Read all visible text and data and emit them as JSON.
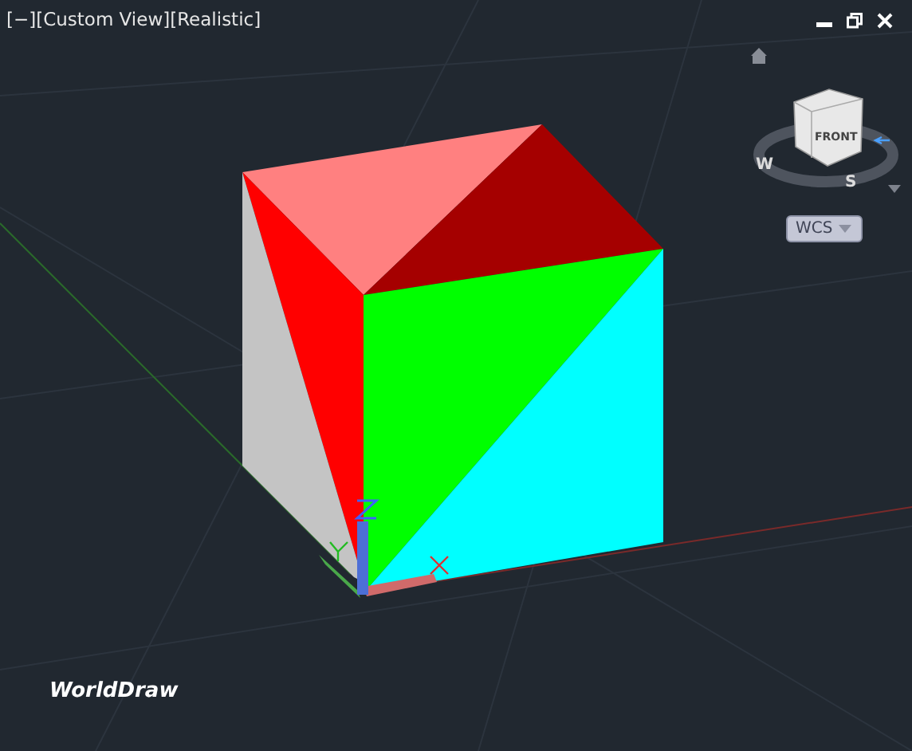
{
  "viewport_controls": [
    {
      "label": "[−]"
    },
    {
      "label": "[Custom View]"
    },
    {
      "label": "[Realistic]"
    }
  ],
  "view_cube": {
    "face": "FRONT",
    "compass": [
      {
        "label": "W"
      },
      {
        "label": "S"
      }
    ]
  },
  "coordinate_system": {
    "label": "WCS"
  },
  "caption": "WorldDraw"
}
